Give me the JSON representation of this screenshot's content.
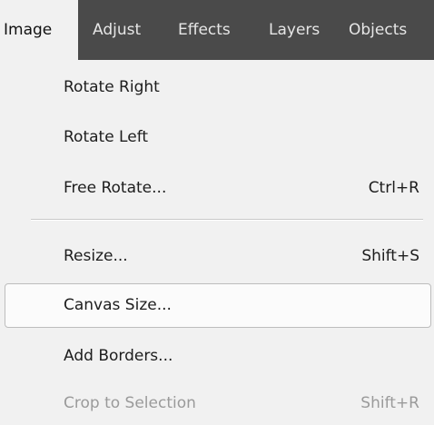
{
  "menubar": {
    "items": [
      {
        "label": "Image",
        "active": true
      },
      {
        "label": "Adjust"
      },
      {
        "label": "Effects"
      },
      {
        "label": "Layers"
      },
      {
        "label": "Objects"
      }
    ]
  },
  "image_menu": {
    "items": [
      {
        "label": "Rotate Right",
        "shortcut": ""
      },
      {
        "label": "Rotate Left",
        "shortcut": ""
      },
      {
        "label": "Free Rotate...",
        "shortcut": "Ctrl+R"
      },
      {
        "label": "Resize...",
        "shortcut": "Shift+S"
      },
      {
        "label": "Canvas Size...",
        "shortcut": "",
        "highlighted": true
      },
      {
        "label": "Add Borders...",
        "shortcut": ""
      },
      {
        "label": "Crop to Selection",
        "shortcut": "Shift+R",
        "disabled": true
      }
    ]
  },
  "colors": {
    "menubar_bg": "#4a4a4a",
    "menu_bg": "#f1f1f1",
    "disabled_text": "#9a9a9a"
  }
}
